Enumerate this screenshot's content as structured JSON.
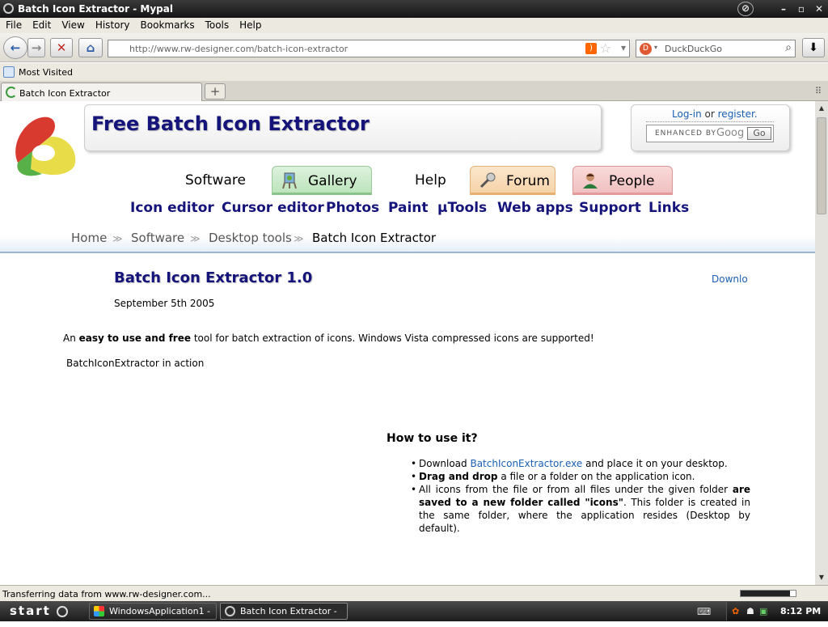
{
  "window": {
    "title": "Batch Icon Extractor - Mypal",
    "minimize": "–",
    "maximize": "▫",
    "close": "✕"
  },
  "menu": [
    "File",
    "Edit",
    "View",
    "History",
    "Bookmarks",
    "Tools",
    "Help"
  ],
  "nav": {
    "url": "http://www.rw-designer.com/batch-icon-extractor",
    "search_placeholder": "DuckDuckGo",
    "back_icon": "←",
    "forward_icon": "→",
    "stop_icon": "✕",
    "home_icon": "⌂",
    "download_icon": "⬇"
  },
  "bookmarks": {
    "most_visited": "Most Visited"
  },
  "tabs": {
    "active": "Batch Icon Extractor",
    "new_tab": "+"
  },
  "site": {
    "title": "Free Batch Icon Extractor",
    "login": "Log-in",
    "or": "or",
    "register": "register.",
    "search_brand": "ENHANCED BY",
    "search_google": "Goog",
    "search_go": "Go",
    "categories": [
      "Software",
      "Gallery",
      "Help",
      "Forum",
      "People"
    ],
    "subnav": [
      "Icon editor",
      "Cursor editor",
      "Photos",
      "Paint",
      "µTools",
      "Web apps",
      "Support",
      "Links"
    ],
    "breadcrumb": [
      "Home",
      "Software",
      "Desktop tools",
      "Batch Icon Extractor"
    ],
    "breadcrumb_sep": "≫"
  },
  "article": {
    "heading": "Batch Icon Extractor 1.0",
    "date": "September 5th 2005",
    "download_link": "Downlo",
    "intro_pre": "An ",
    "intro_bold": "easy to use and free",
    "intro_post": " tool for batch extraction of icons. Windows Vista compressed icons are supported!",
    "caption": "BatchIconExtractor in action",
    "howto_title": "How to use it?",
    "steps": [
      {
        "pre": "Download ",
        "link": "BatchIconExtractor.exe",
        "post": " and place it on your desktop."
      },
      {
        "bold": "Drag and drop",
        "post": " a file or a folder on the application icon."
      },
      {
        "pre": "All icons from the file or from all files under the given folder ",
        "bold": "are saved to a new folder called \"icons\"",
        "post": ". This folder is created in the same folder, where the application resides (Desktop by default)."
      }
    ]
  },
  "status": {
    "text": "Transferring data from www.rw-designer.com...",
    "progress": 0.9
  },
  "taskbar": {
    "start": "start",
    "tasks": [
      "WindowsApplication1 - ...",
      "Batch Icon Extractor - ..."
    ],
    "clock": "8:12 PM"
  },
  "colors": {
    "link": "#1a5fb4",
    "title": "#14147a",
    "gallery": "#bde4bd",
    "forum": "#f6d3a8",
    "people": "#f0c0c0"
  }
}
